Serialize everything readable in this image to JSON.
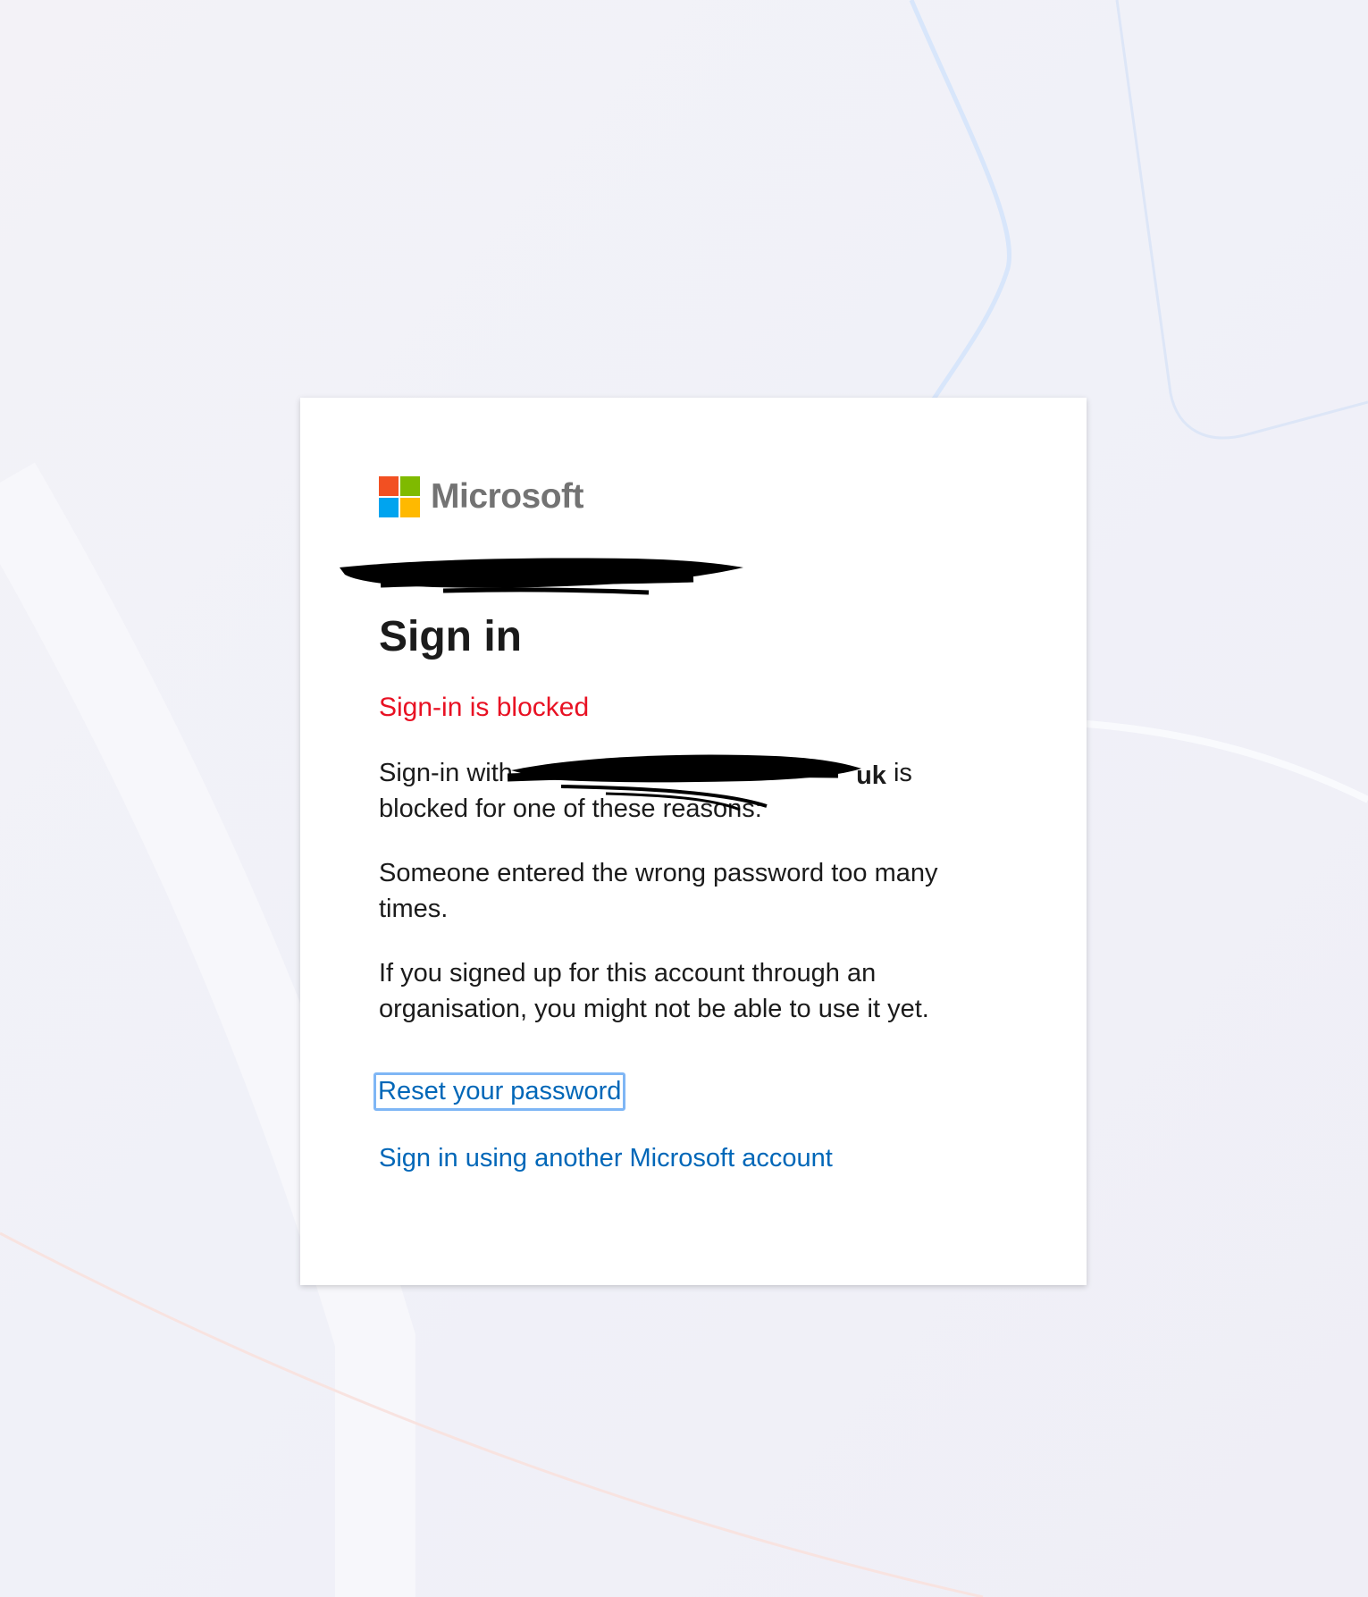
{
  "brand": {
    "name": "Microsoft",
    "colors": {
      "red": "#f25022",
      "green": "#7fba00",
      "blue": "#00a4ef",
      "yellow": "#ffb900"
    }
  },
  "identity": {
    "redacted": true
  },
  "heading": "Sign in",
  "error": {
    "text": "Sign-in is blocked",
    "color": "#e81123"
  },
  "message": {
    "prefix": "Sign-in with",
    "email_visible_tail": "uk",
    "suffix": " is blocked for one of these reasons:"
  },
  "reasons": [
    "Someone entered the wrong password too many times.",
    "If you signed up for this account through an organisation, you might not be able to use it yet."
  ],
  "links": {
    "reset_password": "Reset your password",
    "other_account": "Sign in using another Microsoft account",
    "color": "#0067b8"
  }
}
